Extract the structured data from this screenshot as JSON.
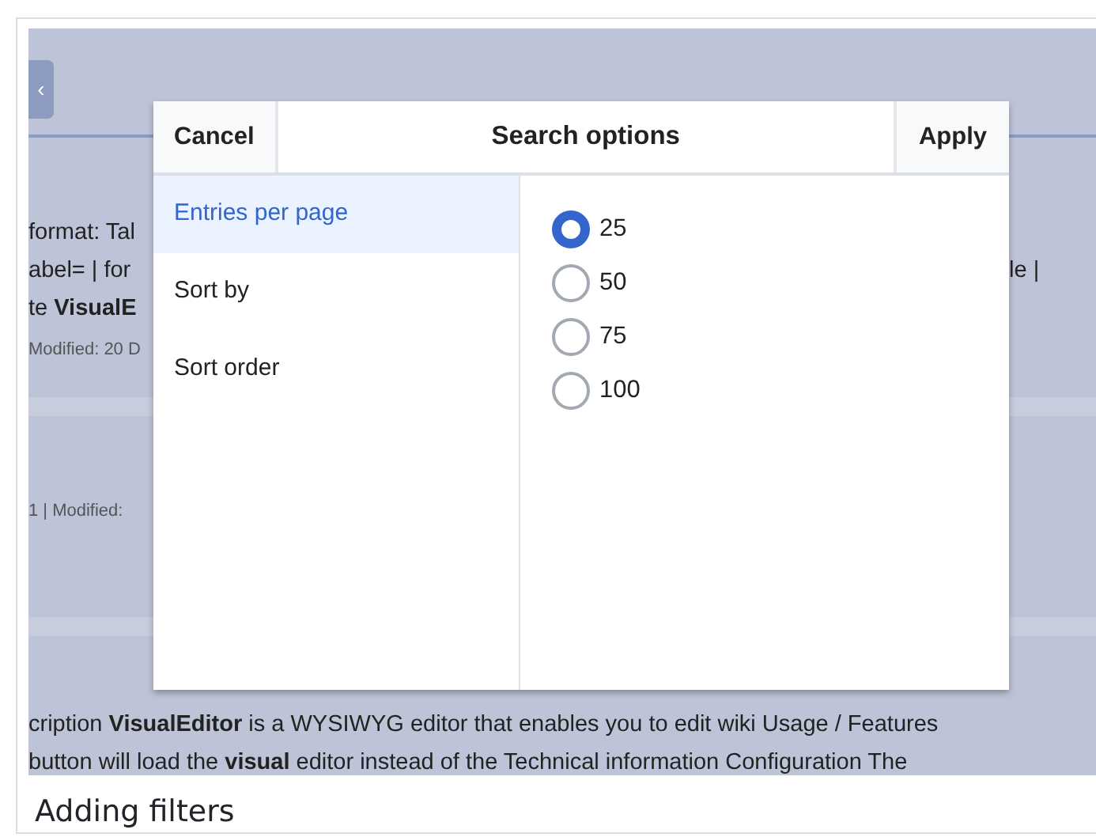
{
  "screenshot": {
    "back_button": "‹",
    "background_left": [
      "format: Tal",
      "abel= | for",
      "te **VisualE**",
      "Modified: 20 D"
    ],
    "background_right": [
      "le |"
    ],
    "background_meta": "1 | Modified:",
    "background_bottom": [
      "cription **VisualEditor** is a WYSIWYG editor that enables you to edit wiki Usage / Features",
      "button will load the **visual** editor instead of the Technical information Configuration The"
    ],
    "dialog": {
      "cancel": "Cancel",
      "title": "Search options",
      "apply": "Apply",
      "menu": [
        {
          "label": "Entries per page",
          "selected": true
        },
        {
          "label": "Sort by",
          "selected": false
        },
        {
          "label": "Sort order",
          "selected": false
        }
      ],
      "options": [
        {
          "label": "25",
          "selected": true
        },
        {
          "label": "50",
          "selected": false
        },
        {
          "label": "75",
          "selected": false
        },
        {
          "label": "100",
          "selected": false
        }
      ]
    }
  },
  "caption": "Adding filters"
}
